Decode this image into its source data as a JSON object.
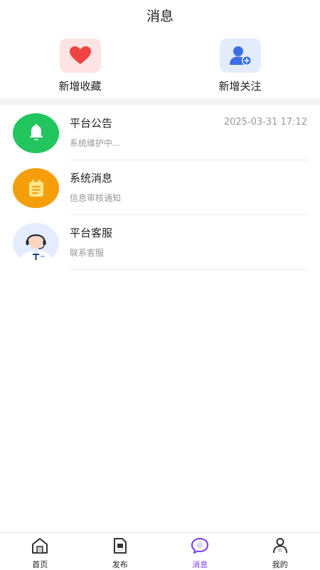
{
  "header": {
    "title": "消息"
  },
  "quick_actions": [
    {
      "label": "新增收藏",
      "icon": "heart-icon"
    },
    {
      "label": "新增关注",
      "icon": "add-user-icon"
    }
  ],
  "messages": [
    {
      "title": "平台公告",
      "subtitle": "系统维护中...",
      "time": "2025-03-31 17:12",
      "icon": "bell-icon",
      "color": "#22c55e"
    },
    {
      "title": "系统消息",
      "subtitle": "信息审核通知",
      "time": "",
      "icon": "notepad-icon",
      "color": "#f59e0b"
    },
    {
      "title": "平台客服",
      "subtitle": "联系客服",
      "time": "",
      "icon": "customer-service-icon",
      "color": "#e6ecff"
    }
  ],
  "tabbar": {
    "items": [
      {
        "label": "首页",
        "icon": "home-icon"
      },
      {
        "label": "发布",
        "icon": "publish-icon"
      },
      {
        "label": "消息",
        "icon": "message-icon",
        "active": true
      },
      {
        "label": "我的",
        "icon": "profile-icon"
      }
    ],
    "active_color": "#7c3aed"
  }
}
